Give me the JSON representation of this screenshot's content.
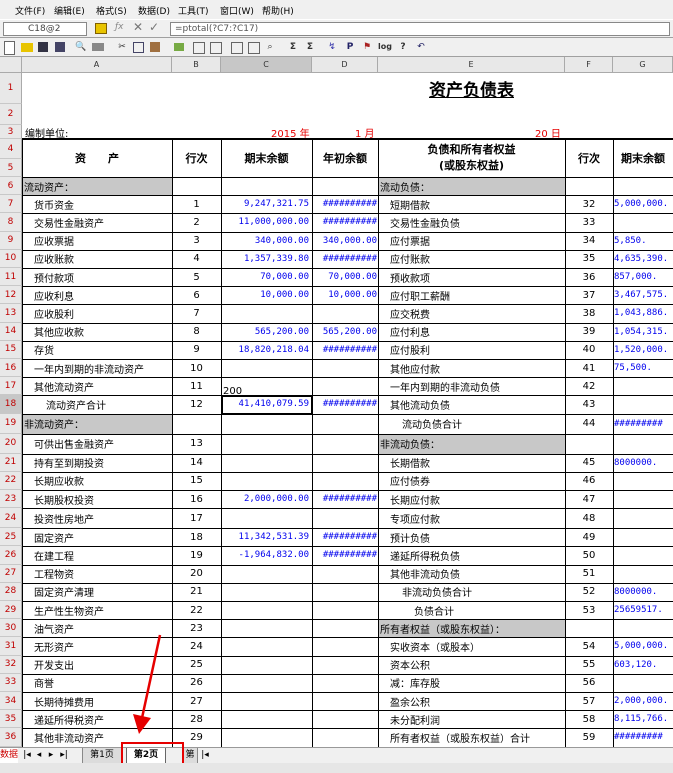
{
  "menu": [
    "文件(F)",
    "编辑(E)",
    "格式(S)",
    "数据(D)",
    "工具(T)",
    "窗口(W)",
    "帮助(H)"
  ],
  "formula_bar": {
    "cell_ref": "C18@2",
    "formula": "=ptotal(?C7:?C17)"
  },
  "columns": [
    "A",
    "B",
    "C",
    "D",
    "E",
    "F",
    "G"
  ],
  "sheet": {
    "title": "资产负债表",
    "unit_label": "编制单位:",
    "date_year": "2015 年",
    "date_month": "1 月",
    "date_day": "20 日",
    "headers": {
      "asset": "资　　产",
      "line": "行次",
      "end_balance": "期末余额",
      "begin_balance": "年初余额",
      "liab_line1": "负债和所有者权益",
      "liab_line2": "(或股东权益)",
      "line2": "行次",
      "end_balance2": "期末余额"
    },
    "overflow_text": "200",
    "rows": [
      {
        "r": "6",
        "a": "流动资产：",
        "b": "",
        "c": "",
        "d": "",
        "e": "流动负债：",
        "f": "",
        "g": ""
      },
      {
        "r": "7",
        "a": "货币资金",
        "b": "1",
        "c": "9,247,321.75",
        "d": "##########",
        "e": "短期借款",
        "f": "32",
        "g": "5,000,000."
      },
      {
        "r": "8",
        "a": "交易性金融资产",
        "b": "2",
        "c": "11,000,000.00",
        "d": "##########",
        "e": "交易性金融负债",
        "f": "33",
        "g": ""
      },
      {
        "r": "9",
        "a": "应收票据",
        "b": "3",
        "c": "340,000.00",
        "d": "340,000.00",
        "e": "应付票据",
        "f": "34",
        "g": "5,850."
      },
      {
        "r": "10",
        "a": "应收账款",
        "b": "4",
        "c": "1,357,339.80",
        "d": "##########",
        "e": "应付账款",
        "f": "35",
        "g": "4,635,390."
      },
      {
        "r": "11",
        "a": "预付款项",
        "b": "5",
        "c": "70,000.00",
        "d": "70,000.00",
        "e": "预收款项",
        "f": "36",
        "g": "857,000."
      },
      {
        "r": "12",
        "a": "应收利息",
        "b": "6",
        "c": "10,000.00",
        "d": "10,000.00",
        "e": "应付职工薪酬",
        "f": "37",
        "g": "3,467,575."
      },
      {
        "r": "13",
        "a": "应收股利",
        "b": "7",
        "c": "",
        "d": "",
        "e": "应交税费",
        "f": "38",
        "g": "1,043,886."
      },
      {
        "r": "14",
        "a": "其他应收款",
        "b": "8",
        "c": "565,200.00",
        "d": "565,200.00",
        "e": "应付利息",
        "f": "39",
        "g": "1,054,315."
      },
      {
        "r": "15",
        "a": "存货",
        "b": "9",
        "c": "18,820,218.04",
        "d": "##########",
        "e": "应付股利",
        "f": "40",
        "g": "1,520,000."
      },
      {
        "r": "16",
        "a": "一年内到期的非流动资产",
        "b": "10",
        "c": "",
        "d": "",
        "e": "其他应付款",
        "f": "41",
        "g": "75,500."
      },
      {
        "r": "17",
        "a": "其他流动资产",
        "b": "11",
        "c": "",
        "d": "",
        "e": "一年内到期的非流动负债",
        "f": "42",
        "g": ""
      },
      {
        "r": "18",
        "a": "流动资产合计",
        "b": "12",
        "c": "41,410,079.59",
        "d": "##########",
        "e": "其他流动负债",
        "f": "43",
        "g": ""
      },
      {
        "r": "19",
        "a": "非流动资产：",
        "b": "",
        "c": "",
        "d": "",
        "e": "流动负债合计",
        "f": "44",
        "g": "#########"
      },
      {
        "r": "20",
        "a": "可供出售金融资产",
        "b": "13",
        "c": "",
        "d": "",
        "e": "非流动负债：",
        "f": "",
        "g": ""
      },
      {
        "r": "21",
        "a": "持有至到期投资",
        "b": "14",
        "c": "",
        "d": "",
        "e": "长期借款",
        "f": "45",
        "g": "8000000."
      },
      {
        "r": "22",
        "a": "长期应收款",
        "b": "15",
        "c": "",
        "d": "",
        "e": "应付债券",
        "f": "46",
        "g": ""
      },
      {
        "r": "23",
        "a": "长期股权投资",
        "b": "16",
        "c": "2,000,000.00",
        "d": "##########",
        "e": "长期应付款",
        "f": "47",
        "g": ""
      },
      {
        "r": "24",
        "a": "投资性房地产",
        "b": "17",
        "c": "",
        "d": "",
        "e": "专项应付款",
        "f": "48",
        "g": ""
      },
      {
        "r": "25",
        "a": "固定资产",
        "b": "18",
        "c": "11,342,531.39",
        "d": "##########",
        "e": "预计负债",
        "f": "49",
        "g": ""
      },
      {
        "r": "26",
        "a": "在建工程",
        "b": "19",
        "c": "-1,964,832.00",
        "d": "##########",
        "e": "递延所得税负债",
        "f": "50",
        "g": ""
      },
      {
        "r": "27",
        "a": "工程物资",
        "b": "20",
        "c": "",
        "d": "",
        "e": "其他非流动负债",
        "f": "51",
        "g": ""
      },
      {
        "r": "28",
        "a": "固定资产清理",
        "b": "21",
        "c": "",
        "d": "",
        "e": "非流动负债合计",
        "f": "52",
        "g": "8000000."
      },
      {
        "r": "29",
        "a": "生产性生物资产",
        "b": "22",
        "c": "",
        "d": "",
        "e": "负债合计",
        "f": "53",
        "g": "25659517."
      },
      {
        "r": "30",
        "a": "油气资产",
        "b": "23",
        "c": "",
        "d": "",
        "e": "所有者权益（或股东权益）：",
        "f": "",
        "g": ""
      },
      {
        "r": "31",
        "a": "无形资产",
        "b": "24",
        "c": "",
        "d": "",
        "e": "实收资本（或股本）",
        "f": "54",
        "g": "5,000,000."
      },
      {
        "r": "32",
        "a": "开发支出",
        "b": "25",
        "c": "",
        "d": "",
        "e": "资本公积",
        "f": "55",
        "g": "603,120."
      },
      {
        "r": "33",
        "a": "商誉",
        "b": "26",
        "c": "",
        "d": "",
        "e": "减：库存股",
        "f": "56",
        "g": ""
      },
      {
        "r": "34",
        "a": "长期待摊费用",
        "b": "27",
        "c": "",
        "d": "",
        "e": "盈余公积",
        "f": "57",
        "g": "2,000,000."
      },
      {
        "r": "35",
        "a": "递延所得税资产",
        "b": "28",
        "c": "",
        "d": "",
        "e": "未分配利润",
        "f": "58",
        "g": "8,115,766."
      },
      {
        "r": "36",
        "a": "其他非流动资产",
        "b": "29",
        "c": "",
        "d": "",
        "e": "所有者权益（或股东权益）合计",
        "f": "59",
        "g": "#########"
      }
    ]
  },
  "tabs": {
    "left_label": "数据",
    "page1": "第1页",
    "page2": "第2页",
    "page3": "第"
  },
  "colors": {
    "accent_red": "#e60000",
    "number_blue": "#0000ee",
    "section_gray": "#c8c8c8"
  }
}
